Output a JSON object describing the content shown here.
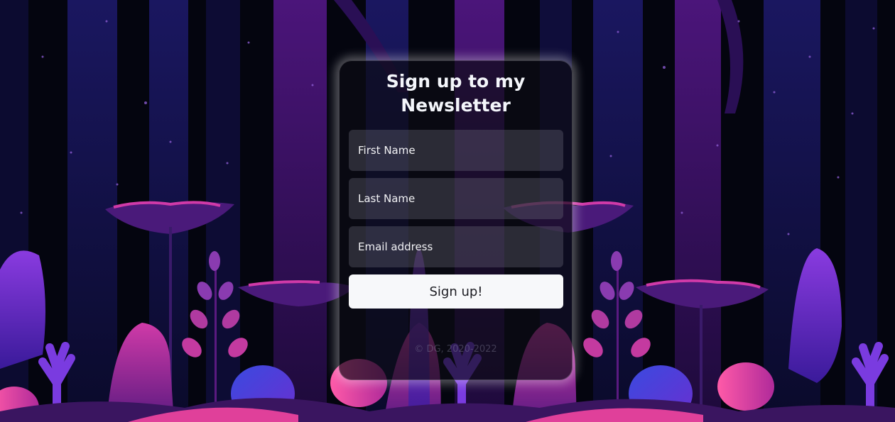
{
  "form": {
    "title_line1": "Sign up to my",
    "title_line2": "Newsletter",
    "first_name_placeholder": "First Name",
    "last_name_placeholder": "Last Name",
    "email_placeholder": "Email address",
    "submit_label": "Sign up!",
    "footer_text": "© DG, 2020-2022"
  },
  "colors": {
    "background": "#04050f",
    "tree_blue": "#14124a",
    "tree_purple": "#3b1266",
    "plant_magenta": "#c42f9a",
    "plant_violet": "#6a2fd0",
    "plant_pink": "#ff4fa0",
    "button": "#f7f8fa"
  }
}
